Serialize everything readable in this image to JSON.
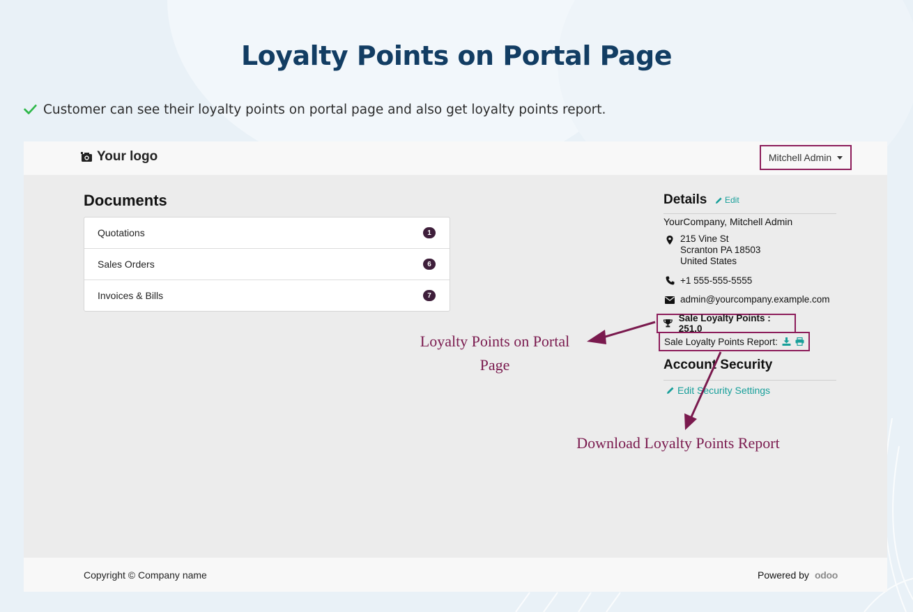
{
  "banner": {
    "title": "Loyalty Points on Portal Page",
    "feature_text": "Customer can see their loyalty points on portal page and also get loyalty points report."
  },
  "portal": {
    "logo_text": "Your logo",
    "user_menu_label": "Mitchell Admin",
    "documents": {
      "title": "Documents",
      "items": [
        {
          "label": "Quotations",
          "count": "1"
        },
        {
          "label": "Sales Orders",
          "count": "6"
        },
        {
          "label": "Invoices & Bills",
          "count": "7"
        }
      ]
    },
    "details": {
      "title": "Details",
      "edit_label": "Edit",
      "company": "YourCompany, Mitchell Admin",
      "address_line1": "215 Vine St",
      "address_line2": "Scranton PA 18503",
      "address_line3": "United States",
      "phone": "+1 555-555-5555",
      "email": "admin@yourcompany.example.com",
      "loyalty_points": "Sale Loyalty Points : 251.0",
      "loyalty_report_label": "Sale Loyalty Points Report:"
    },
    "security": {
      "title": "Account Security",
      "link_label": "Edit Security Settings"
    },
    "footer": {
      "copyright": "Copyright © Company name",
      "powered_by": "Powered by",
      "brand": "odoo"
    }
  },
  "annotations": {
    "loyalty_points_line1": "Loyalty Points on Portal",
    "loyalty_points_line2": "Page",
    "download_report": "Download Loyalty Points Report"
  },
  "colors": {
    "accent": "#8c1c5a",
    "link": "#179f9a",
    "heading": "#123d63",
    "badge": "#3e1e3a",
    "check": "#2fb84a"
  }
}
